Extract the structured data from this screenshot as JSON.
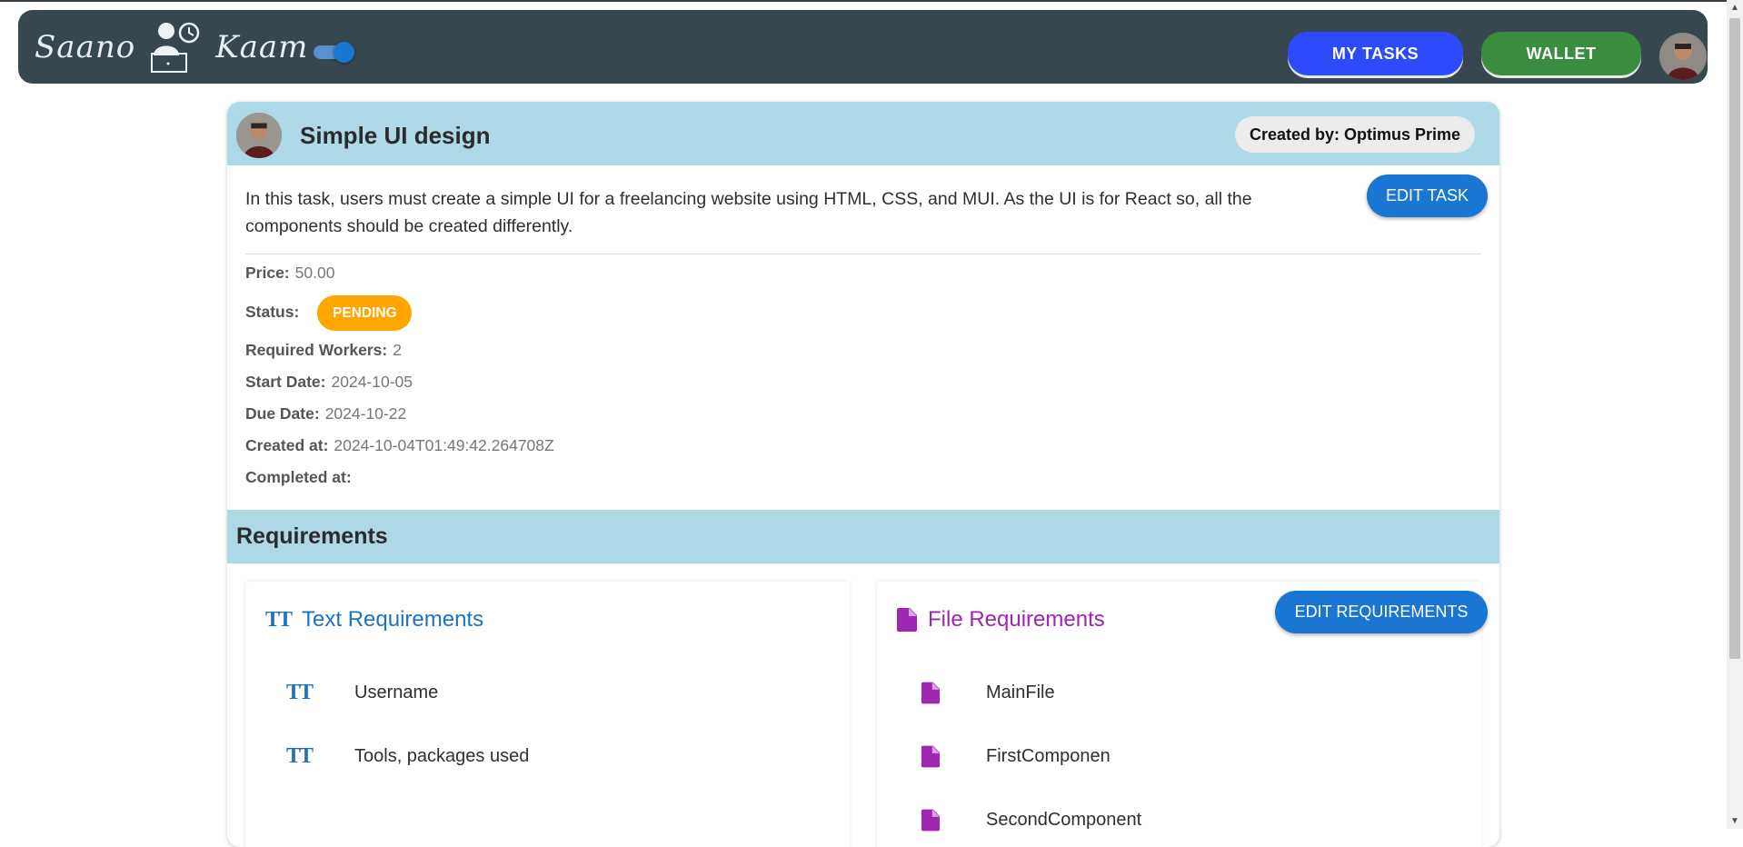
{
  "navbar": {
    "logo_left": "Saano",
    "logo_right": "Kaam",
    "my_tasks_label": "MY TASKS",
    "wallet_label": "WALLET",
    "theme_toggle_on": true
  },
  "task": {
    "title": "Simple UI design",
    "created_by": "Created by: Optimus Prime",
    "edit_label": "EDIT TASK",
    "description": "In this task, users must create a simple UI for a freelancing website using HTML, CSS, and MUI. As the UI is for React so, all the components should be created differently.",
    "fields": {
      "price_label": "Price:",
      "price": "50.00",
      "status_label": "Status:",
      "status": "PENDING",
      "workers_label": "Required Workers:",
      "workers": "2",
      "start_label": "Start Date:",
      "start": "2024-10-05",
      "due_label": "Due Date:",
      "due": "2024-10-22",
      "created_label": "Created at:",
      "created": "2024-10-04T01:49:42.264708Z",
      "completed_label": "Completed at:",
      "completed": ""
    }
  },
  "requirements": {
    "title": "Requirements",
    "edit_label": "EDIT REQUIREMENTS",
    "text_title": "Text Requirements",
    "text_items": [
      "Username",
      "Tools, packages used"
    ],
    "file_title": "File Requirements",
    "file_items": [
      "MainFile",
      "FirstComponen",
      "SecondComponent"
    ]
  },
  "colors": {
    "navbar_bg": "#37474f",
    "header_bg": "#add8e6",
    "primary": "#1976d2",
    "my_tasks_bg": "#2d4bfa",
    "wallet_bg": "#3a8c3f",
    "status_pending": "#ffa500",
    "text_req": "#1e73be",
    "file_req": "#9c27b0"
  },
  "icons": {
    "text_requirement": "text-fields-icon",
    "file_requirement": "file-icon"
  }
}
